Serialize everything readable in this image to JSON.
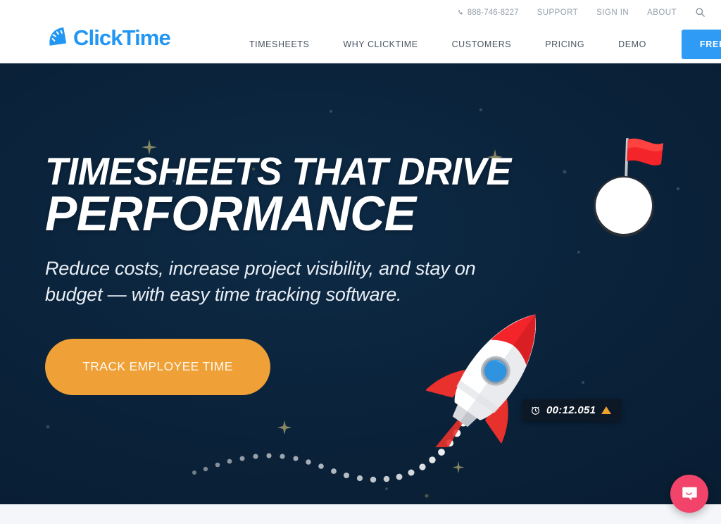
{
  "header": {
    "logo": {
      "text": "ClickTime",
      "icon": "clicktime-logo-mark",
      "color": "#2196f3"
    },
    "utility_nav": {
      "phone": "888-746-8227",
      "phone_icon": "phone-icon",
      "items": [
        {
          "label": "SUPPORT"
        },
        {
          "label": "SIGN IN"
        },
        {
          "label": "ABOUT"
        }
      ],
      "search_icon": "search-icon"
    },
    "main_nav": {
      "items": [
        {
          "label": "TIMESHEETS"
        },
        {
          "label": "WHY CLICKTIME"
        },
        {
          "label": "CUSTOMERS"
        },
        {
          "label": "PRICING"
        },
        {
          "label": "DEMO"
        }
      ],
      "cta": {
        "label": "FREE TRIAL",
        "color": "#2f9bf5"
      }
    }
  },
  "hero": {
    "headline_line1": "TIMESHEETS THAT DRIVE",
    "headline_line2": "PERFORMANCE",
    "subhead": "Reduce costs, increase project visibility, and stay on budget — with easy time tracking software.",
    "cta": {
      "label": "TRACK EMPLOYEE TIME",
      "color": "#efa037"
    },
    "background_color": "#0a2138",
    "timer_badge": {
      "icon": "alarm-clock-icon",
      "value": "00:12.051",
      "indicator": "orange-triangle-up",
      "indicator_color": "#f0a22e"
    },
    "illustration": {
      "rocket": "rocket-illustration",
      "planet_flag": "planet-with-red-flag",
      "trail": "dotted-rocket-trail"
    }
  },
  "chat": {
    "icon": "chat-bubble-icon",
    "color": "#f2446a"
  }
}
